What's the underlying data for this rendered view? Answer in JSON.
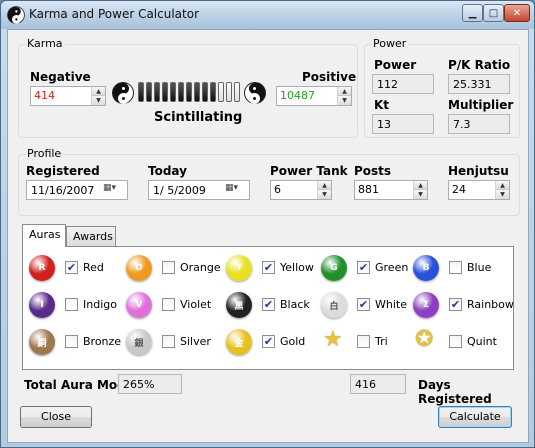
{
  "window": {
    "title": "Karma and Power Calculator"
  },
  "karma": {
    "group_label": "Karma",
    "negative_label": "Negative",
    "negative_value": "414",
    "positive_label": "Positive",
    "positive_value": "10487",
    "status": "Scintillating",
    "bar_filled_fraction": 0.8,
    "colors": {
      "negative": "#e02020",
      "positive": "#20a020"
    }
  },
  "power": {
    "group_label": "Power",
    "power_label": "Power",
    "power_value": "112",
    "pk_ratio_label": "P/K Ratio",
    "pk_ratio_value": "25.331",
    "kt_label": "Kt",
    "kt_value": "13",
    "multiplier_label": "Multiplier",
    "multiplier_value": "7.3"
  },
  "profile": {
    "group_label": "Profile",
    "registered_label": "Registered",
    "registered_value": "11/16/2007",
    "today_label": "Today",
    "today_value": "1/  5/2009",
    "power_tank_label": "Power Tank",
    "power_tank_value": "6",
    "posts_label": "Posts",
    "posts_value": "881",
    "henjutsu_label": "Henjutsu",
    "henjutsu_value": "24"
  },
  "tabs": {
    "auras": "Auras",
    "awards": "Awards"
  },
  "auras": [
    {
      "name": "Red",
      "glyph": "R",
      "color": "#d02020",
      "checked": true
    },
    {
      "name": "Orange",
      "glyph": "O",
      "color": "#f09a20",
      "checked": false
    },
    {
      "name": "Yellow",
      "glyph": "Y",
      "color": "#e8e020",
      "checked": true
    },
    {
      "name": "Green",
      "glyph": "G",
      "color": "#20902a",
      "checked": true
    },
    {
      "name": "Blue",
      "glyph": "B",
      "color": "#2a50d8",
      "checked": false
    },
    {
      "name": "Indigo",
      "glyph": "I",
      "color": "#5a2a8a",
      "checked": false
    },
    {
      "name": "Violet",
      "glyph": "V",
      "color": "#e070d8",
      "checked": false
    },
    {
      "name": "Black",
      "glyph": "黒",
      "color": "#222222",
      "checked": true
    },
    {
      "name": "White",
      "glyph": "白",
      "color": "#dcdcdc",
      "checked": true
    },
    {
      "name": "Rainbow",
      "glyph": "Σ",
      "color": "#8a40c0",
      "checked": true
    },
    {
      "name": "Bronze",
      "glyph": "銅",
      "color": "#a07850",
      "checked": false
    },
    {
      "name": "Silver",
      "glyph": "銀",
      "color": "#c8c8c8",
      "checked": false
    },
    {
      "name": "Gold",
      "glyph": "金",
      "color": "#e8c020",
      "checked": true
    },
    {
      "name": "Tri",
      "glyph": "★",
      "color": "#e8c33a",
      "checked": false
    },
    {
      "name": "Quint",
      "glyph": "✪",
      "color": "#e8c33a",
      "checked": false
    }
  ],
  "footer": {
    "total_aura_mod_label": "Total Aura Mod",
    "total_aura_mod_value": "265%",
    "days_registered_value": "416",
    "days_registered_label": "Days Registered",
    "close_label": "Close",
    "calculate_label": "Calculate"
  }
}
